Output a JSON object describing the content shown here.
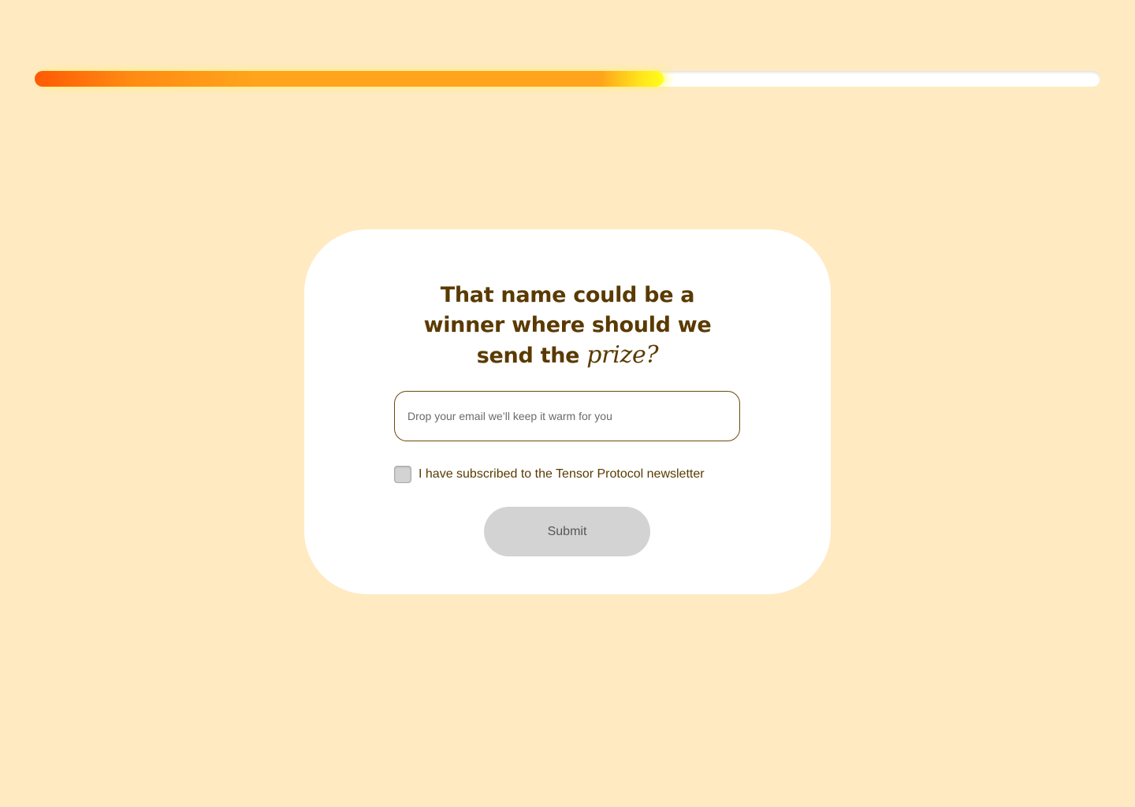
{
  "progress": {
    "fraction": 0.59,
    "fill_colors": [
      "#FF5A05",
      "#FFA41C",
      "#FFFF1A"
    ],
    "track_color": "#FFFFFF"
  },
  "form": {
    "headline_line1": "That name could be a",
    "headline_line2": "winner where should we",
    "headline_line3_prefix": "send the ",
    "headline_line3_italic": "prize?",
    "email_placeholder": "Drop your email we’ll keep it warm for you",
    "email_value": "",
    "newsletter_label": "I have subscribed to the Tensor Protocol newsletter",
    "newsletter_checked": false,
    "submit_label": "Submit"
  },
  "colors": {
    "background": "#FFEAC2",
    "card": "#FFFFFF",
    "text_brown": "#5A3A00",
    "button_disabled": "#D3D3D3"
  }
}
